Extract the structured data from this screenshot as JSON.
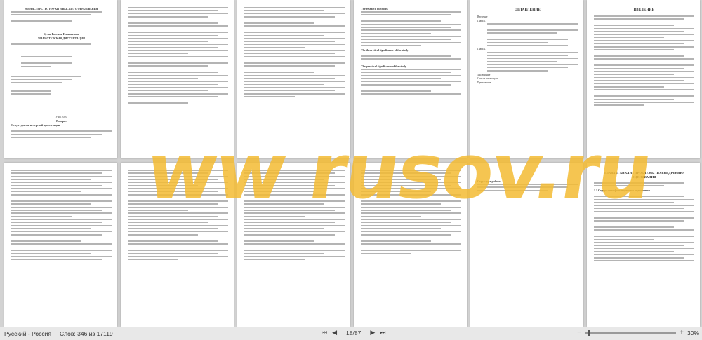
{
  "status_bar": {
    "language": "Русский - Россия",
    "word_count": "Слов: 346 из 17119",
    "page_indicator": "18/87",
    "zoom_percent": "30%",
    "zoom_level": 0.3,
    "icons": [
      "first-page-icon",
      "prev-page-icon",
      "next-page-icon",
      "last-page-icon",
      "zoom-out-icon",
      "zoom-in-icon"
    ]
  },
  "watermark": {
    "text": "ww rusov.ru"
  },
  "pages": {
    "title_page": {
      "header": "МИНИСТЕРСТВО НАУКИ И ВЫСШЕГО ОБРАЗОВАНИЯ",
      "author": "Булат Евгения Ильшатовна",
      "degree": "МАГИСТЕРСКАЯ ДИССЕРТАЦИЯ",
      "city_year": "Уфа 2020"
    },
    "abstract_ru": {
      "title": "Реферат",
      "heading": "Структура магистерской диссертации"
    },
    "abstract_en": {
      "methods": "The research methods",
      "theory": "The theoretical significance of the study",
      "practical": "The practical significance of the study"
    },
    "contents": {
      "title": "ОГЛАВЛЕНИЕ",
      "intro": "Введение",
      "ch1": "Глава 1.",
      "ch2": "Глава 2.",
      "concl": "Заключение",
      "refs": "Список литературы",
      "app": "Приложение"
    },
    "intro": {
      "title": "ВВЕДЕНИЕ"
    },
    "chapter1": {
      "title": "ГЛАВА 1. АНАЛИЗ ПРОБЛЕМЫ ПО ВНЕДРЕНИЮ ОЦЕНИВАНИЯ",
      "sub": "1.1 Содержание формирующего оценивания"
    },
    "structure": {
      "label": "Структура работы."
    }
  }
}
